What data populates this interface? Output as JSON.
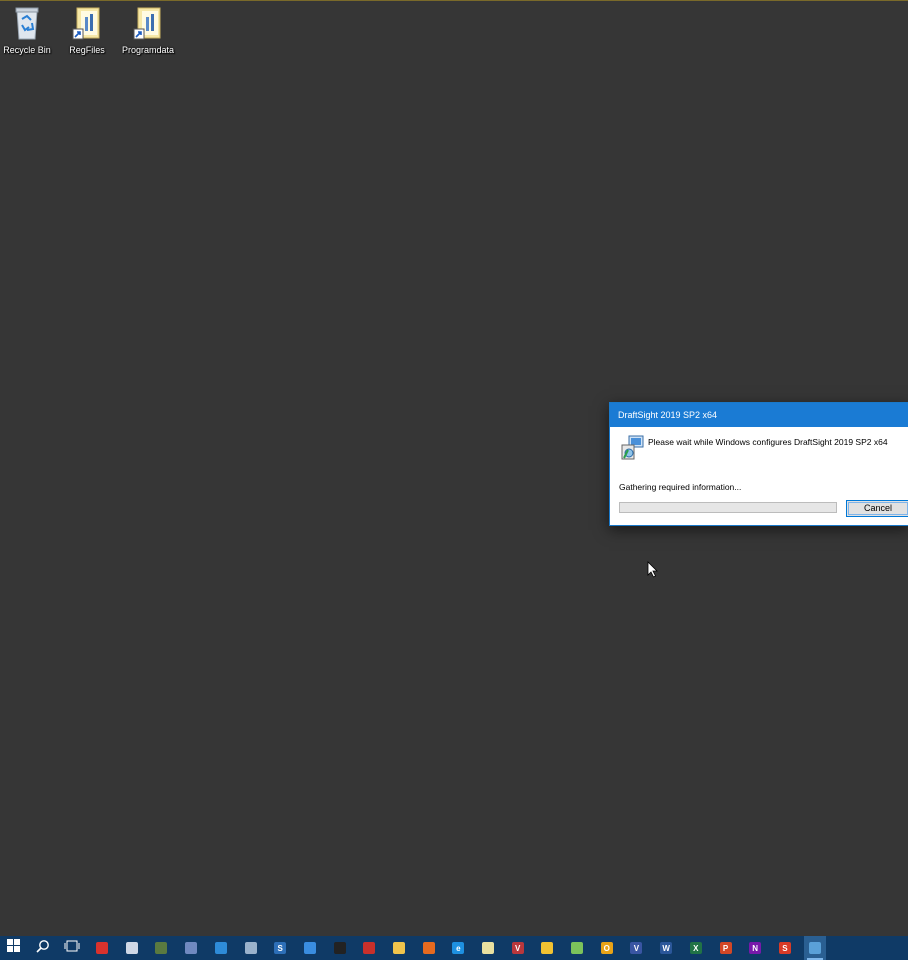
{
  "desktop": {
    "icons": [
      {
        "label": "Recycle Bin",
        "icon": "recycle-bin-icon"
      },
      {
        "label": "RegFiles",
        "icon": "folder-shortcut-icon"
      },
      {
        "label": "Programdata",
        "icon": "folder-shortcut-icon"
      }
    ]
  },
  "dialog": {
    "title": "DraftSight 2019 SP2 x64",
    "message": "Please wait while Windows configures DraftSight 2019 SP2 x64",
    "status": "Gathering required information...",
    "progress": 0,
    "cancel_label": "Cancel",
    "icon": "installer-icon"
  },
  "taskbar": {
    "items": [
      {
        "name": "start",
        "icon": "windows-start-icon",
        "glyph": "",
        "color": ""
      },
      {
        "name": "search",
        "icon": "search-icon",
        "glyph": "",
        "color": ""
      },
      {
        "name": "task-view",
        "icon": "task-view-icon",
        "glyph": "",
        "color": ""
      },
      {
        "name": "shield-app",
        "icon": "shield-icon",
        "glyph": "",
        "color": "#d9322d"
      },
      {
        "name": "notepad",
        "icon": "document-icon",
        "glyph": "",
        "color": "#cfd8e6"
      },
      {
        "name": "app-2019",
        "icon": "app-2019-icon",
        "glyph": "",
        "color": "#5a7a40"
      },
      {
        "name": "globe-app",
        "icon": "globe-icon",
        "glyph": "",
        "color": "#7089c0"
      },
      {
        "name": "teamviewer",
        "icon": "remote-icon",
        "glyph": "",
        "color": "#2e8bd8"
      },
      {
        "name": "network-app",
        "icon": "network-icon",
        "glyph": "",
        "color": "#9ab2cc"
      },
      {
        "name": "s-app",
        "icon": "s-app-icon",
        "glyph": "S",
        "color": "#2d6fb8"
      },
      {
        "name": "edge-app",
        "icon": "edge-icon",
        "glyph": "",
        "color": "#3a8de0"
      },
      {
        "name": "cmd",
        "icon": "terminal-icon",
        "glyph": "",
        "color": "#222222"
      },
      {
        "name": "red-app",
        "icon": "tool-icon",
        "glyph": "",
        "color": "#c8302b"
      },
      {
        "name": "file-explorer",
        "icon": "folder-icon",
        "glyph": "",
        "color": "#f0c44c"
      },
      {
        "name": "firefox",
        "icon": "firefox-icon",
        "glyph": "",
        "color": "#e66a1f"
      },
      {
        "name": "ie",
        "icon": "internet-explorer-icon",
        "glyph": "e",
        "color": "#1e90e0"
      },
      {
        "name": "note-app",
        "icon": "notes-icon",
        "glyph": "",
        "color": "#e8e0a0"
      },
      {
        "name": "vz-app",
        "icon": "vz-icon",
        "glyph": "V",
        "color": "#b8373c"
      },
      {
        "name": "folder-app",
        "icon": "folder-star-icon",
        "glyph": "",
        "color": "#f1c232"
      },
      {
        "name": "chat-app",
        "icon": "chat-icon",
        "glyph": "",
        "color": "#7cc35b"
      },
      {
        "name": "outlook-yellow",
        "icon": "o-app-icon",
        "glyph": "O",
        "color": "#e8a317"
      },
      {
        "name": "visio",
        "icon": "visio-icon",
        "glyph": "V",
        "color": "#3955a3"
      },
      {
        "name": "word",
        "icon": "word-icon",
        "glyph": "W",
        "color": "#2b579a"
      },
      {
        "name": "excel",
        "icon": "excel-icon",
        "glyph": "X",
        "color": "#217346"
      },
      {
        "name": "powerpoint",
        "icon": "powerpoint-icon",
        "glyph": "P",
        "color": "#d24726"
      },
      {
        "name": "onenote",
        "icon": "onenote-icon",
        "glyph": "N",
        "color": "#7719aa"
      },
      {
        "name": "s-red-app",
        "icon": "s-red-icon",
        "glyph": "S",
        "color": "#d83b27"
      },
      {
        "name": "installer",
        "icon": "installer-icon",
        "glyph": "",
        "color": "#5aa0d8"
      }
    ]
  }
}
